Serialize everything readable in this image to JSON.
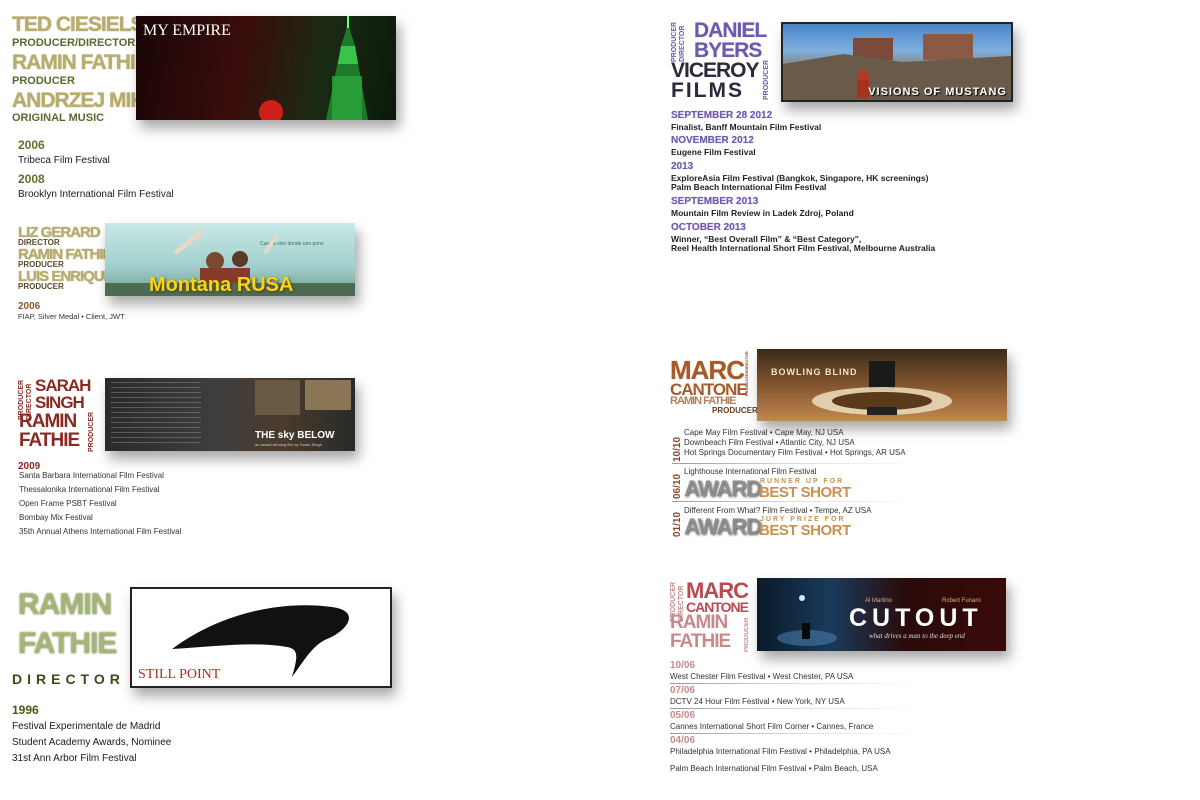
{
  "my_empire": {
    "credits": [
      {
        "name": "TED CIESIELSKI",
        "role": "PRODUCER/DIRECTOR"
      },
      {
        "name": "RAMIN FATHIE",
        "role": "PRODUCER"
      },
      {
        "name": "ANDRZEJ MIKA",
        "role": "ORIGINAL MUSIC"
      }
    ],
    "banner_title": "MY EMPIRE",
    "festivals": [
      {
        "year": "2006",
        "text": "Tribeca Film Festival"
      },
      {
        "year": "2008",
        "text": "Brooklyn International Film Festival"
      }
    ]
  },
  "montana": {
    "credits": [
      {
        "name": "LIZ GERARD",
        "role": "DIRECTOR"
      },
      {
        "name": "RAMIN FATHIE",
        "role": "PRODUCER"
      },
      {
        "name": "LUIS ENRIQUE",
        "role": "PRODUCER"
      }
    ],
    "banner_title": "Montana RUSA",
    "banner_small": "Cuesta vivir donde uno pone",
    "year": "2006",
    "award": "FIAP, Silver Medal • Client, JWT"
  },
  "sky_below": {
    "vertical_role_1": "PRODUCER",
    "vertical_role_2": "DIRECTOR",
    "name_1a": "SARAH",
    "name_1b": "SINGH",
    "name_2a": "RAMIN",
    "name_2b": "FATHIE",
    "vertical_role_3": "PRODUCER",
    "banner_title": "THE sky BELOW",
    "banner_sub": "an award winning film by Sarah Singh",
    "year": "2009",
    "festivals": [
      "Santa Barbara International Film Festival",
      "Thessalonika International Film Festival",
      "Open Frame PSBT Festival",
      "Bombay Mix Festival",
      "35th Annual Athens International Film Festival"
    ]
  },
  "still_point": {
    "name_1": "RAMIN",
    "name_2": "FATHIE",
    "role": "DIRECTOR",
    "banner_title": "STILL POINT",
    "year": "1996",
    "festivals": [
      "Festival Experimentale de Madrid",
      "Student Academy Awards, Nominee",
      "31st Ann Arbor Film Festival"
    ]
  },
  "mustang": {
    "vertical_role_1": "PRODUCER",
    "vertical_role_2": "DIRECTOR",
    "name_1": "DANIEL",
    "name_2": "BYERS",
    "company_1": "VICEROY",
    "company_2": "FILMS",
    "vertical_role_3": "PRODUCER",
    "banner_title": "VISIONS OF MUSTANG",
    "events": [
      {
        "date": "SEPTEMBER 28 2012",
        "lines": [
          "Finalist, Banff Mountain Film Festival"
        ]
      },
      {
        "date": "NOVEMBER 2012",
        "lines": [
          "Eugene Film Festival"
        ]
      },
      {
        "date": "2013",
        "lines": [
          "ExploreAsia Film Festival (Bangkok, Singapore, HK screenings)",
          "Palm Beach International Film Festival"
        ]
      },
      {
        "date": "SEPTEMBER 2013",
        "lines": [
          "Mountain Film Review in Ladek Zdroj, Poland"
        ]
      },
      {
        "date": "OCTOBER 2013",
        "lines": [
          "Winner, “Best Overall Film” & “Best Category”,",
          "Reel Health International Short Film Festival, Melbourne Australia"
        ]
      }
    ]
  },
  "bowling": {
    "name_1": "MARC",
    "name_2": "CANTONE",
    "vertical_role_1": "PRODUCER/DIRECTOR",
    "name_3": "RAMIN FATHIE",
    "role_3": "PRODUCER",
    "banner_title": "BOWLING BLIND",
    "groups": [
      {
        "date": "10/10",
        "lines": [
          "Cape May Film Festival • Cape May, NJ USA",
          "Downbeach Film Festival • Atlantic City, NJ USA",
          "Hot Springs Documentary Film Festival • Hot Springs, AR USA"
        ]
      },
      {
        "date": "06/10",
        "lines": [
          "Lighthouse International Film Festival"
        ],
        "award": "AWARD",
        "award_sub": "RUNNER UP FOR",
        "award_best": "BEST SHORT"
      },
      {
        "date": "01/10",
        "lines": [
          "Different From What? Film Festival • Tempe, AZ USA"
        ],
        "award": "AWARD",
        "award_sub": "JURY PRIZE FOR",
        "award_best": "BEST SHORT"
      }
    ]
  },
  "cutout": {
    "vertical_role_1": "PRODUCER",
    "vertical_role_2": "DIRECTOR",
    "name_1": "MARC",
    "name_2": "CANTONE",
    "name_3": "RAMIN",
    "name_4": "FATHIE",
    "vertical_role_3": "PRODUCER",
    "banner_title": "CUTOUT",
    "banner_actor_1": "Al Martino",
    "banner_actor_2": "Robert Funaro",
    "banner_tagline": "what drives a man to the deep end",
    "screenings": [
      {
        "date": "10/06",
        "text": "West Chester Film Festival • West Chester, PA USA"
      },
      {
        "date": "07/06",
        "text": "DCTV 24 Hour Film Festival • New York, NY USA"
      },
      {
        "date": "05/06",
        "text": "Cannes International Short Film Corner • Cannes, France"
      },
      {
        "date": "04/06",
        "text": "Philadelphia International Film Festival •  Philadelphia, PA USA"
      },
      {
        "date": "",
        "text": "Palm Beach International Film Festival • Palm Beach, USA"
      }
    ]
  }
}
